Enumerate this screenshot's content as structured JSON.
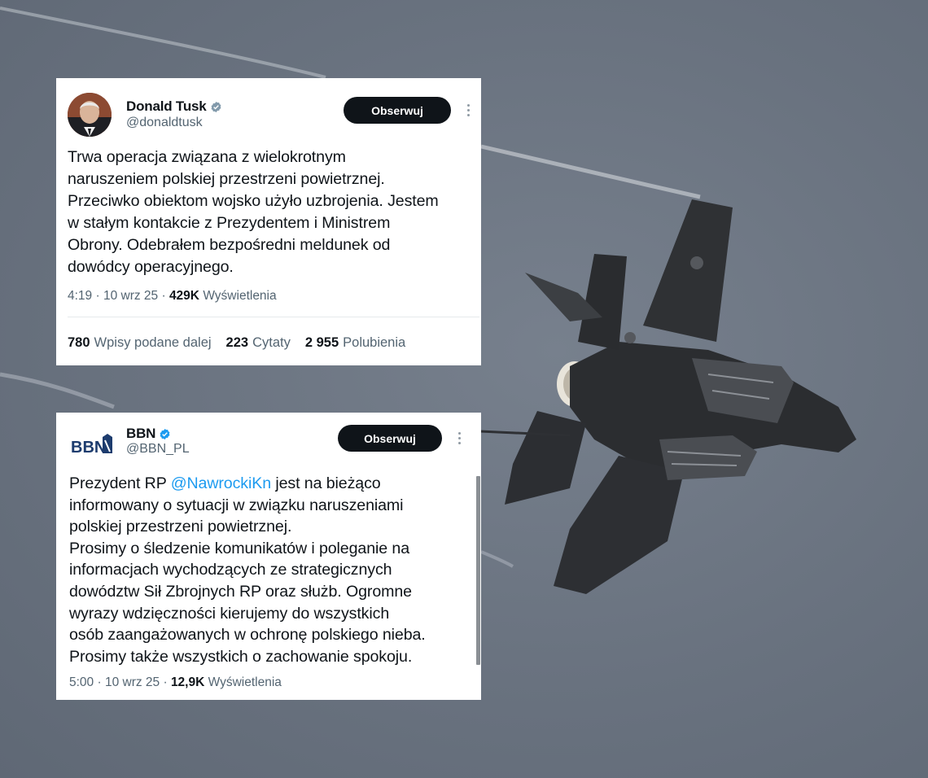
{
  "tweets": [
    {
      "author_name": "Donald Tusk",
      "handle": "@donaldtusk",
      "follow_label": "Obserwuj",
      "text_lines": [
        "Trwa operacja związana z wielokrotnym",
        "naruszeniem polskiej przestrzeni powietrznej.",
        "Przeciwko obiektom wojsko użyło uzbrojenia. Jestem",
        "w stałym kontakcie z Prezydentem i Ministrem",
        "Obrony. Odebrałem bezpośredni meldunek od",
        "dowódcy operacyjnego."
      ],
      "time": "4:19",
      "date": "10 wrz 25",
      "views": "429K",
      "views_label": "Wyświetlenia",
      "reposts": "780",
      "reposts_label": "Wpisy podane dalej",
      "quotes": "223",
      "quotes_label": "Cytaty",
      "likes": "2 955",
      "likes_label": "Polubienia",
      "verified_color": "#829aab",
      "icons": [
        "avatar",
        "verified-badge-icon",
        "more-icon"
      ]
    },
    {
      "author_name": "BBN",
      "handle": "@BBN_PL",
      "follow_label": "Obserwuj",
      "logo_text": "BBN",
      "text_prefix": "Prezydent RP ",
      "mention": "@NawrockiKn",
      "text_line1_suffix": " jest na bieżąco",
      "text_lines": [
        "informowany o sytuacji w związku naruszeniami",
        "polskiej przestrzeni powietrznej.",
        "Prosimy o śledzenie komunikatów i poleganie na",
        "informacjach wychodzących ze strategicznych",
        "dowództw Sił Zbrojnych RP oraz służb. Ogromne",
        "wyrazy wdzięczności kierujemy do wszystkich",
        "osób zaangażowanych w ochronę polskiego nieba.",
        "Prosimy także wszystkich o zachowanie spokoju."
      ],
      "time": "5:00",
      "date": "10 wrz 25",
      "views": "12,9K",
      "views_label": "Wyświetlenia",
      "verified_color": "#1d9bf0",
      "mention_color": "#1d9bf0",
      "icons": [
        "bbn-logo",
        "verified-badge-icon",
        "more-icon"
      ]
    }
  ],
  "background": {
    "subject": "fighter-jet-image",
    "sky_color": "#6c7583"
  }
}
